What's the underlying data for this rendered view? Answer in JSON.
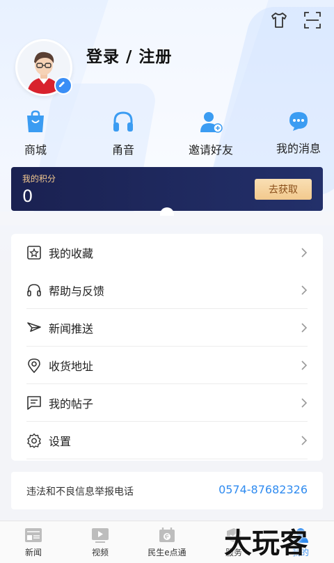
{
  "header": {
    "login_text": "登录 / 注册"
  },
  "icons": {
    "top_right": [
      "shirt-icon",
      "scan-icon"
    ]
  },
  "quick_actions": [
    {
      "label": "商城",
      "icon": "shopping-bag-icon"
    },
    {
      "label": "甬音",
      "icon": "headphones-icon"
    },
    {
      "label": "邀请好友",
      "icon": "invite-user-icon"
    },
    {
      "label": "我的消息",
      "icon": "message-bubble-icon"
    }
  ],
  "points": {
    "label": "我的积分",
    "value": "0",
    "button": "去获取"
  },
  "menu": [
    {
      "label": "我的收藏",
      "icon": "star-box-icon"
    },
    {
      "label": "帮助与反馈",
      "icon": "headset-icon"
    },
    {
      "label": "新闻推送",
      "icon": "send-icon"
    },
    {
      "label": "收货地址",
      "icon": "location-pin-icon"
    },
    {
      "label": "我的帖子",
      "icon": "post-icon"
    },
    {
      "label": "设置",
      "icon": "gear-icon"
    }
  ],
  "report": {
    "label": "违法和不良信息举报电话",
    "phone": "0574-87682326"
  },
  "tabs": [
    {
      "label": "新闻",
      "icon": "news-icon"
    },
    {
      "label": "视频",
      "icon": "video-icon"
    },
    {
      "label": "民生e点通",
      "icon": "calendar-e-icon"
    },
    {
      "label": "服务",
      "icon": "service-icon"
    },
    {
      "label": "我的",
      "icon": "profile-icon",
      "active": true
    }
  ],
  "watermark": "大玩客",
  "colors": {
    "accent": "#2f8bf0",
    "points_bg": "#1a2151",
    "points_button": "#f2c98d"
  }
}
